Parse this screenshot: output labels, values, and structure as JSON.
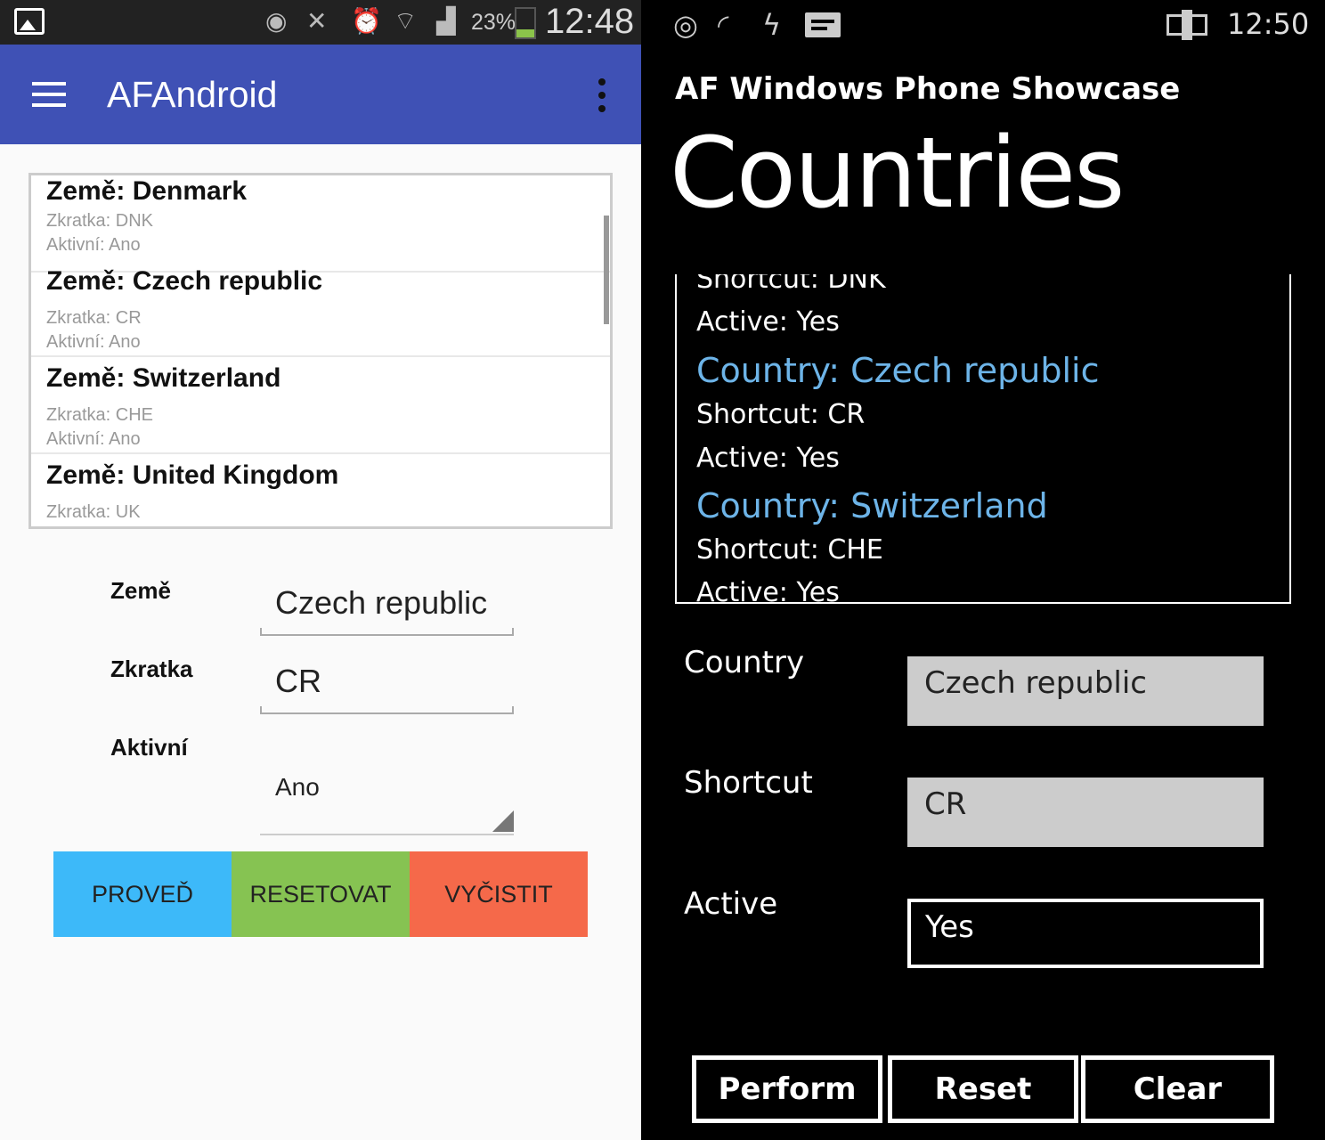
{
  "android": {
    "status": {
      "battery_pct": "23%",
      "time": "12:48"
    },
    "appbar": {
      "title": "AFAndroid"
    },
    "list": [
      {
        "name": "Země: Denmark",
        "abbr": "Zkratka: DNK",
        "active": "Aktivní: Ano"
      },
      {
        "name": "Země: Czech republic",
        "abbr": "Zkratka: CR",
        "active": "Aktivní: Ano"
      },
      {
        "name": "Země: Switzerland",
        "abbr": "Zkratka: CHE",
        "active": "Aktivní: Ano"
      },
      {
        "name": "Země: United Kingdom",
        "abbr": "Zkratka: UK",
        "active": ""
      }
    ],
    "form": {
      "country_label": "Země",
      "country_value": "Czech republic",
      "shortcut_label": "Zkratka",
      "shortcut_value": "CR",
      "active_label": "Aktivní",
      "active_value": "Ano"
    },
    "buttons": {
      "perform": "PROVEĎ",
      "reset": "RESETOVAT",
      "clear": "VYČISTIT"
    },
    "colors": {
      "appbar": "#3f51b5",
      "perform": "#3db9f9",
      "reset": "#86c352",
      "clear": "#f5694a"
    }
  },
  "wp": {
    "status": {
      "time": "12:50"
    },
    "app_title": "AF Windows Phone Showcase",
    "page_title": "Countries",
    "list_lines": [
      {
        "text": "Shortcut: DNK",
        "kind": "detail"
      },
      {
        "text": "Active: Yes",
        "kind": "detail"
      },
      {
        "text": "Country: Czech republic",
        "kind": "country"
      },
      {
        "text": "Shortcut: CR",
        "kind": "detail"
      },
      {
        "text": "Active: Yes",
        "kind": "detail"
      },
      {
        "text": "Country: Switzerland",
        "kind": "country"
      },
      {
        "text": "Shortcut: CHE",
        "kind": "detail"
      },
      {
        "text": "Active: Yes",
        "kind": "detail"
      }
    ],
    "form": {
      "country_label": "Country",
      "country_value": "Czech republic",
      "shortcut_label": "Shortcut",
      "shortcut_value": "CR",
      "active_label": "Active",
      "active_value": "Yes"
    },
    "buttons": {
      "perform": "Perform",
      "reset": "Reset",
      "clear": "Clear"
    },
    "colors": {
      "accent": "#6db4e8"
    }
  }
}
